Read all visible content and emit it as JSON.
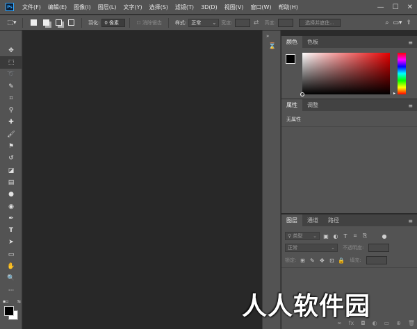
{
  "app": {
    "logo_text": "Ps"
  },
  "menu": [
    "文件(F)",
    "编辑(E)",
    "图像(I)",
    "图层(L)",
    "文字(Y)",
    "选择(S)",
    "滤镜(T)",
    "3D(D)",
    "视图(V)",
    "窗口(W)",
    "帮助(H)"
  ],
  "window_controls": {
    "minimize": "—",
    "maximize": "☐",
    "close": "✕"
  },
  "options": {
    "feather_label": "羽化:",
    "feather_value": "0 像素",
    "antialias_label": "消除锯齿",
    "style_label": "样式:",
    "style_value": "正常",
    "width_label": "宽度:",
    "height_label": "高度:",
    "select_subject": "选择并遮住..."
  },
  "panels": {
    "color": {
      "tabs": [
        "颜色",
        "色板"
      ],
      "fg_color": "#000000",
      "bg_color": "#ffffff",
      "field_hue": "#e60000"
    },
    "properties": {
      "tabs": [
        "属性",
        "调整"
      ],
      "empty_text": "无属性"
    },
    "layers": {
      "tabs": [
        "图层",
        "通道",
        "路径"
      ],
      "filter_kind": "类型",
      "blend_mode": "正常",
      "opacity_label": "不透明度:",
      "lock_label": "锁定:",
      "fill_label": "填充:"
    }
  },
  "watermark": "人人软件园"
}
